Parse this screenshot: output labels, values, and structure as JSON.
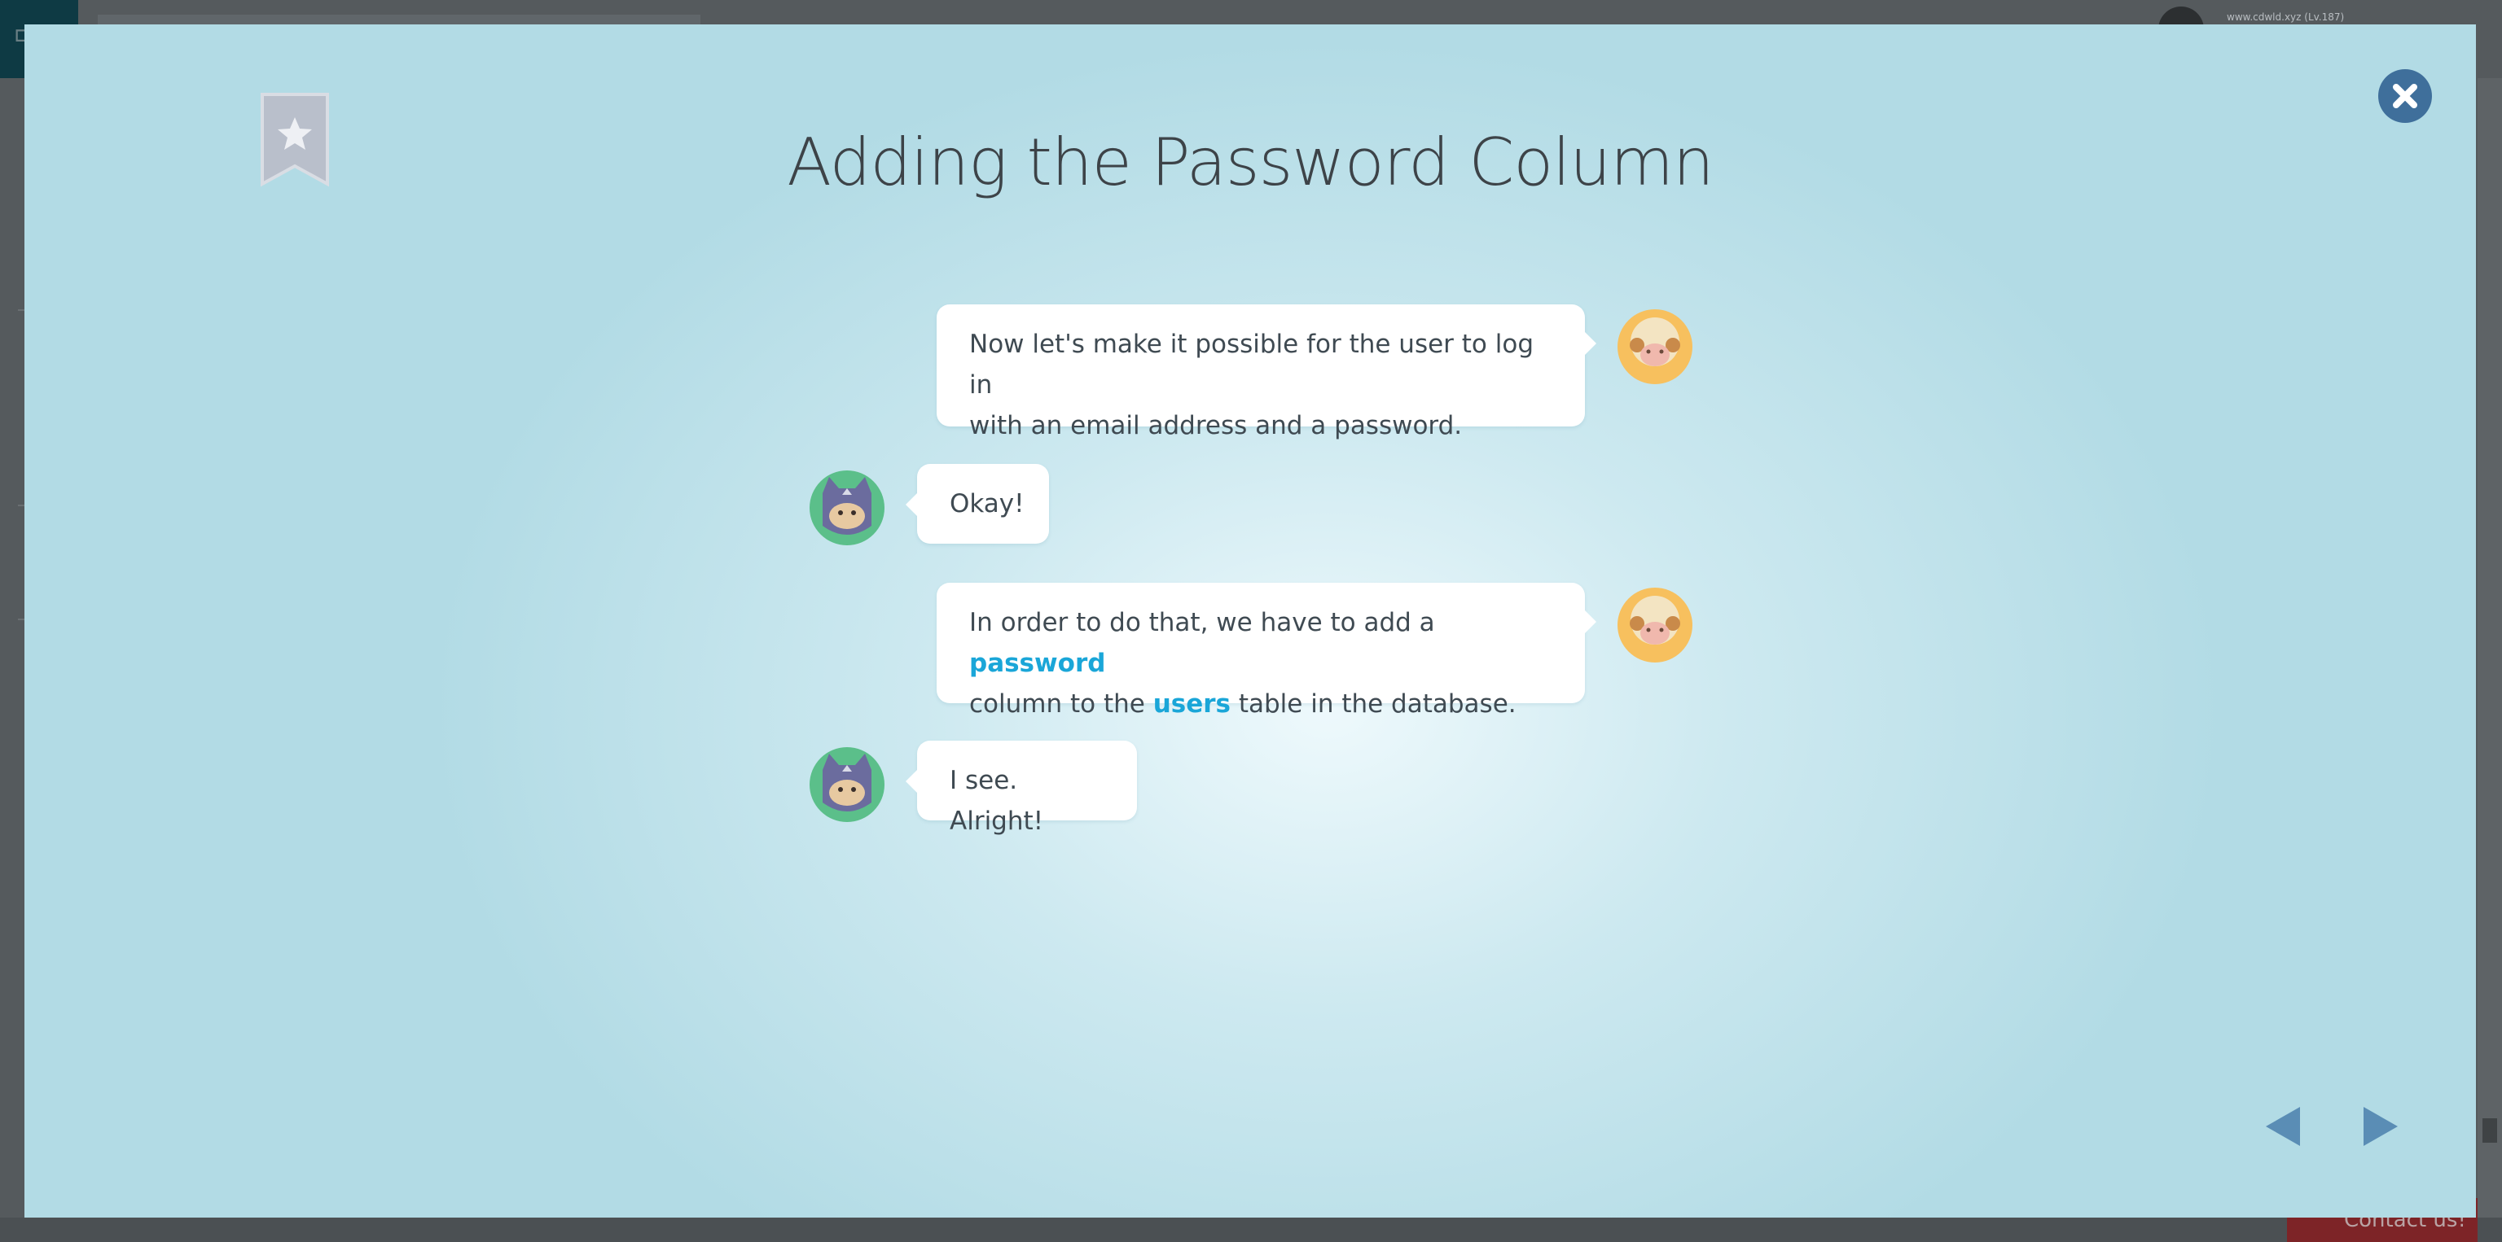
{
  "background_app": {
    "user_info": "www.cdwld.xyz (Lv.187)",
    "contact_label": "Contact us!"
  },
  "modal": {
    "title": "Adding the Password Column",
    "messages": [
      {
        "speaker": "sheep",
        "side": "right",
        "parts": [
          {
            "text": "Now let's make it possible for the user to log in"
          },
          {
            "text": "with an email address and a password."
          }
        ]
      },
      {
        "speaker": "ninja-cat",
        "side": "left",
        "text": "Okay!"
      },
      {
        "speaker": "sheep",
        "side": "right",
        "line1_prefix": "In order to do that, we have to add a ",
        "line1_keyword": "password",
        "line2_prefix": "column to the ",
        "line2_keyword": "users",
        "line2_suffix": " table in the database."
      },
      {
        "speaker": "ninja-cat",
        "side": "left",
        "text": "I see. Alright!"
      }
    ]
  },
  "colors": {
    "keyword": "#1aa6d8",
    "close_button": "#3f6f9b",
    "nav_arrow": "#5a8db5",
    "bookmark": "#b9bfcb"
  },
  "icons": {
    "bookmark": "bookmark-star-icon",
    "close": "close-icon",
    "prev": "prev-arrow-icon",
    "next": "next-arrow-icon",
    "sheep_avatar": "sheep-avatar",
    "cat_avatar": "ninja-cat-avatar"
  }
}
